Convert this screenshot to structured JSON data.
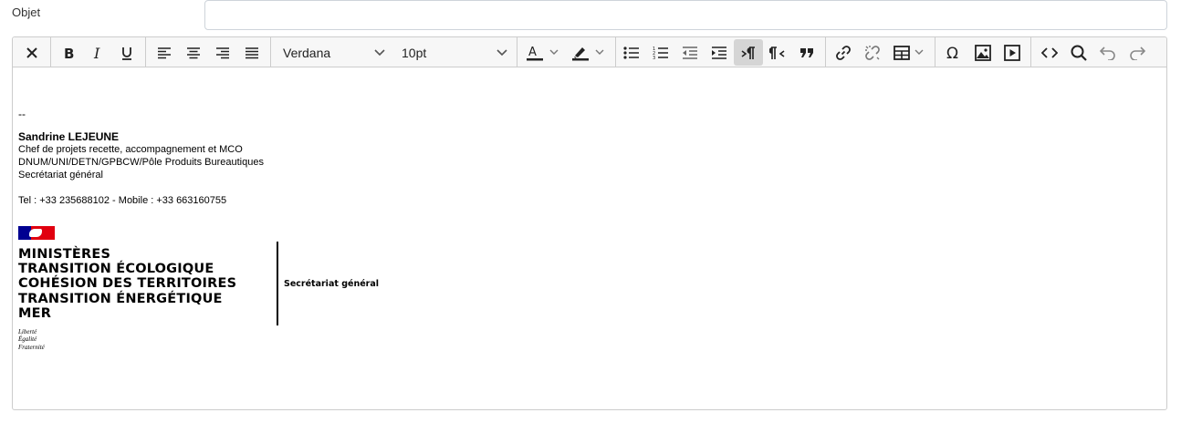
{
  "subject": {
    "label": "Objet",
    "value": ""
  },
  "toolbar": {
    "font_family": "Verdana",
    "font_size": "10pt",
    "buttons": [
      "clear-formatting",
      "bold",
      "italic",
      "underline",
      "align-left",
      "align-center",
      "align-right",
      "justify",
      "text-color",
      "highlight-color",
      "bullet-list",
      "numbered-list",
      "outdent",
      "indent",
      "ltr",
      "rtl",
      "blockquote",
      "link",
      "unlink",
      "table",
      "special-character",
      "image",
      "media",
      "source-code",
      "search-replace",
      "undo",
      "redo"
    ]
  },
  "signature": {
    "dashes": "--",
    "name": "Sandrine LEJEUNE",
    "title": "Chef de projets recette, accompagnement et MCO",
    "department": "DNUM/UNI/DETN/GPBCW/Pôle Produits Bureautiques",
    "service": "Secrétariat général",
    "phone": "Tel : +33 235688102 - Mobile : +33 663160755",
    "logo": {
      "line1": "MINISTÈRES",
      "line2": "TRANSITION ÉCOLOGIQUE",
      "line3": "COHÉSION DES TERRITOIRES",
      "line4": "TRANSITION ÉNERGÉTIQUE",
      "line5": "MER",
      "motto1": "Liberté",
      "motto2": "Égalité",
      "motto3": "Fraternité",
      "side_label": "Secrétariat général"
    }
  },
  "colors": {
    "flag_blue": "#000091",
    "flag_red": "#e1000f",
    "toolbar_bg": "#f7f7f7"
  }
}
